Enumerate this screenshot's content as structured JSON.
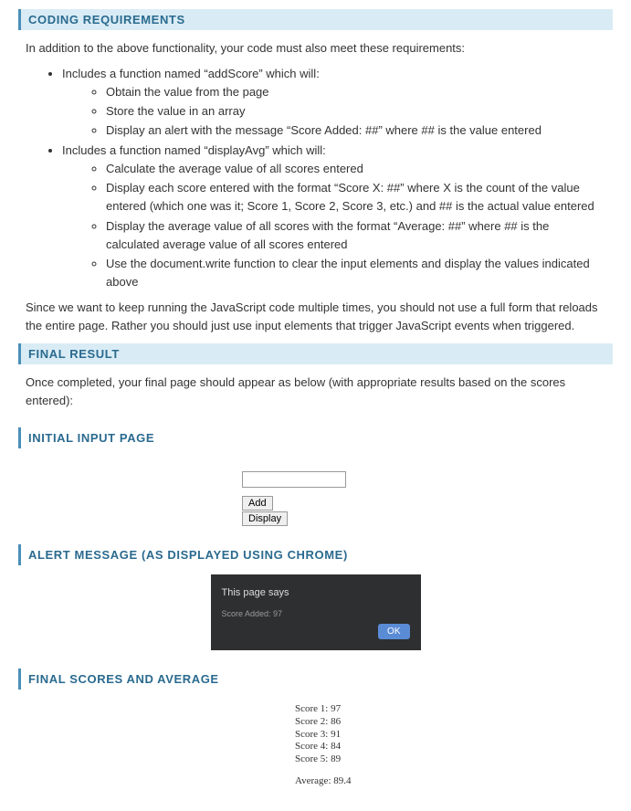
{
  "headers": {
    "coding": "CODING REQUIREMENTS",
    "final_result": "FINAL RESULT",
    "initial_input": "INITIAL INPUT PAGE",
    "alert_message": "ALERT MESSAGE (AS DISPLAYED USING CHROME)",
    "final_scores": "FINAL SCORES AND AVERAGE"
  },
  "intro": "In addition to the above functionality, your code must also meet these requirements:",
  "req1": {
    "lead": "Includes a function named “addScore” which will:",
    "items": [
      "Obtain the value from the page",
      "Store the value in an array",
      "Display an alert with the message “Score Added: ##” where ## is the value entered"
    ]
  },
  "req2": {
    "lead": "Includes a function named “displayAvg” which will:",
    "items": [
      "Calculate the average value of all scores entered",
      "Display each score entered with the format “Score X: ##” where X is the count of the value entered (which one was it; Score 1, Score 2, Score 3, etc.) and ## is the actual value entered",
      "Display the average value of all scores with the format “Average: ##” where ## is the calculated average value of all scores entered",
      "Use the document.write function to clear the input elements and display the values indicated above"
    ]
  },
  "since": "Since we want to keep running the JavaScript code multiple times, you should not use a full form that reloads the entire page.  Rather you should just use input elements that trigger JavaScript events when triggered.",
  "final_desc": "Once completed, your final page should appear as below (with appropriate results based on the scores entered):",
  "buttons": {
    "add": "Add",
    "display": "Display"
  },
  "alert": {
    "title": "This page says",
    "message": "Score Added: 97",
    "ok": "OK"
  },
  "output": {
    "scores": [
      "Score 1: 97",
      "Score 2: 86",
      "Score 3: 91",
      "Score 4: 84",
      "Score 5: 89"
    ],
    "average": "Average: 89.4"
  }
}
